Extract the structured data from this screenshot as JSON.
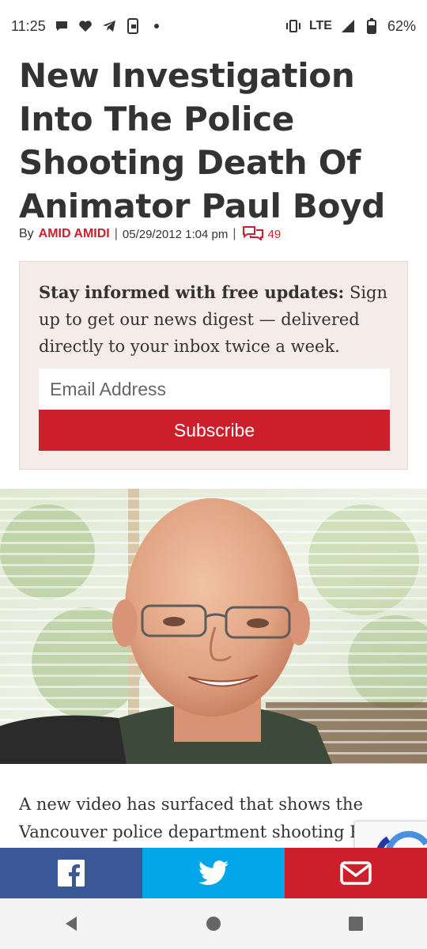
{
  "status_bar": {
    "time": "11:25",
    "network": "LTE",
    "battery": "62%",
    "left_icons": [
      "chat-bubble-icon",
      "heart-icon",
      "telegram-icon",
      "phone-screen-icon",
      "dot-icon"
    ],
    "right_icons": [
      "vibrate-icon",
      "signal-icon",
      "battery-icon"
    ]
  },
  "article": {
    "headline": "New Investigation Into The Police Shooting Death Of Animator Paul Boyd",
    "by_prefix": "By",
    "author": "AMID AMIDI",
    "date": "05/29/2012 1:04 pm",
    "comment_count": "49",
    "lead_text": "A new video has surfaced that shows the Vancouver police department shooting Paul"
  },
  "signup": {
    "bold_text": "Stay informed with free updates:",
    "text": " Sign up to get our news digest — delivered directly to your inbox twice a week.",
    "email_placeholder": "Email Address",
    "subscribe_label": "Subscribe"
  },
  "share_bar": {
    "facebook_icon": "facebook-icon",
    "twitter_icon": "twitter-icon",
    "email_icon": "email-icon"
  },
  "colors": {
    "accent_red": "#cc1f2b",
    "facebook_blue": "#3b5998",
    "twitter_blue": "#00a6e8",
    "signup_bg": "#f5ebe9"
  }
}
